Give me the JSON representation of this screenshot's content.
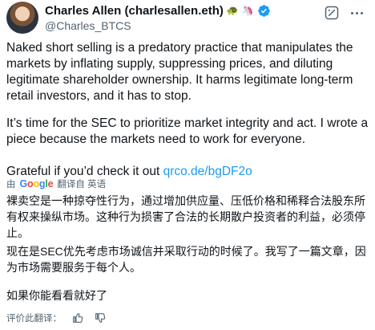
{
  "author": {
    "display_name": "Charles Allen (charlesallen.eth)",
    "emoji_1": "🐢",
    "emoji_2": "🦄",
    "handle": "@Charles_BTCS"
  },
  "tweet": {
    "paragraph_1": "Naked short selling is a predatory practice that manipulates the markets by inflating supply, suppressing prices, and diluting legitimate shareholder ownership. It harms legitimate long-term retail investors, and it has to stop.",
    "paragraph_2": "It’s time for the SEC to prioritize market integrity and act. I wrote a piece because the markets need to work for everyone.",
    "paragraph_3_text": "Grateful if you’d check it out ",
    "paragraph_3_link": "qrco.de/bgDF2o"
  },
  "translation": {
    "by_label": "由",
    "google_letters": [
      "G",
      "o",
      "o",
      "g",
      "l",
      "e"
    ],
    "translated_from": "翻译自 英语",
    "paragraph_1": "裸卖空是一种掠夺性行为，通过增加供应量、压低价格和稀释合法股东所有权来操纵市场。这种行为损害了合法的长期散户投资者的利益，必须停止。",
    "paragraph_2": "现在是SEC优先考虑市场诚信并采取行动的时候了。我写了一篇文章，因为市场需要服务于每个人。",
    "paragraph_3": "如果你能看看就好了"
  },
  "feedback": {
    "label": "评价此翻译："
  },
  "colors": {
    "link": "#1d9bf0",
    "verified": "#1d9bf0",
    "text_secondary": "#536471"
  }
}
